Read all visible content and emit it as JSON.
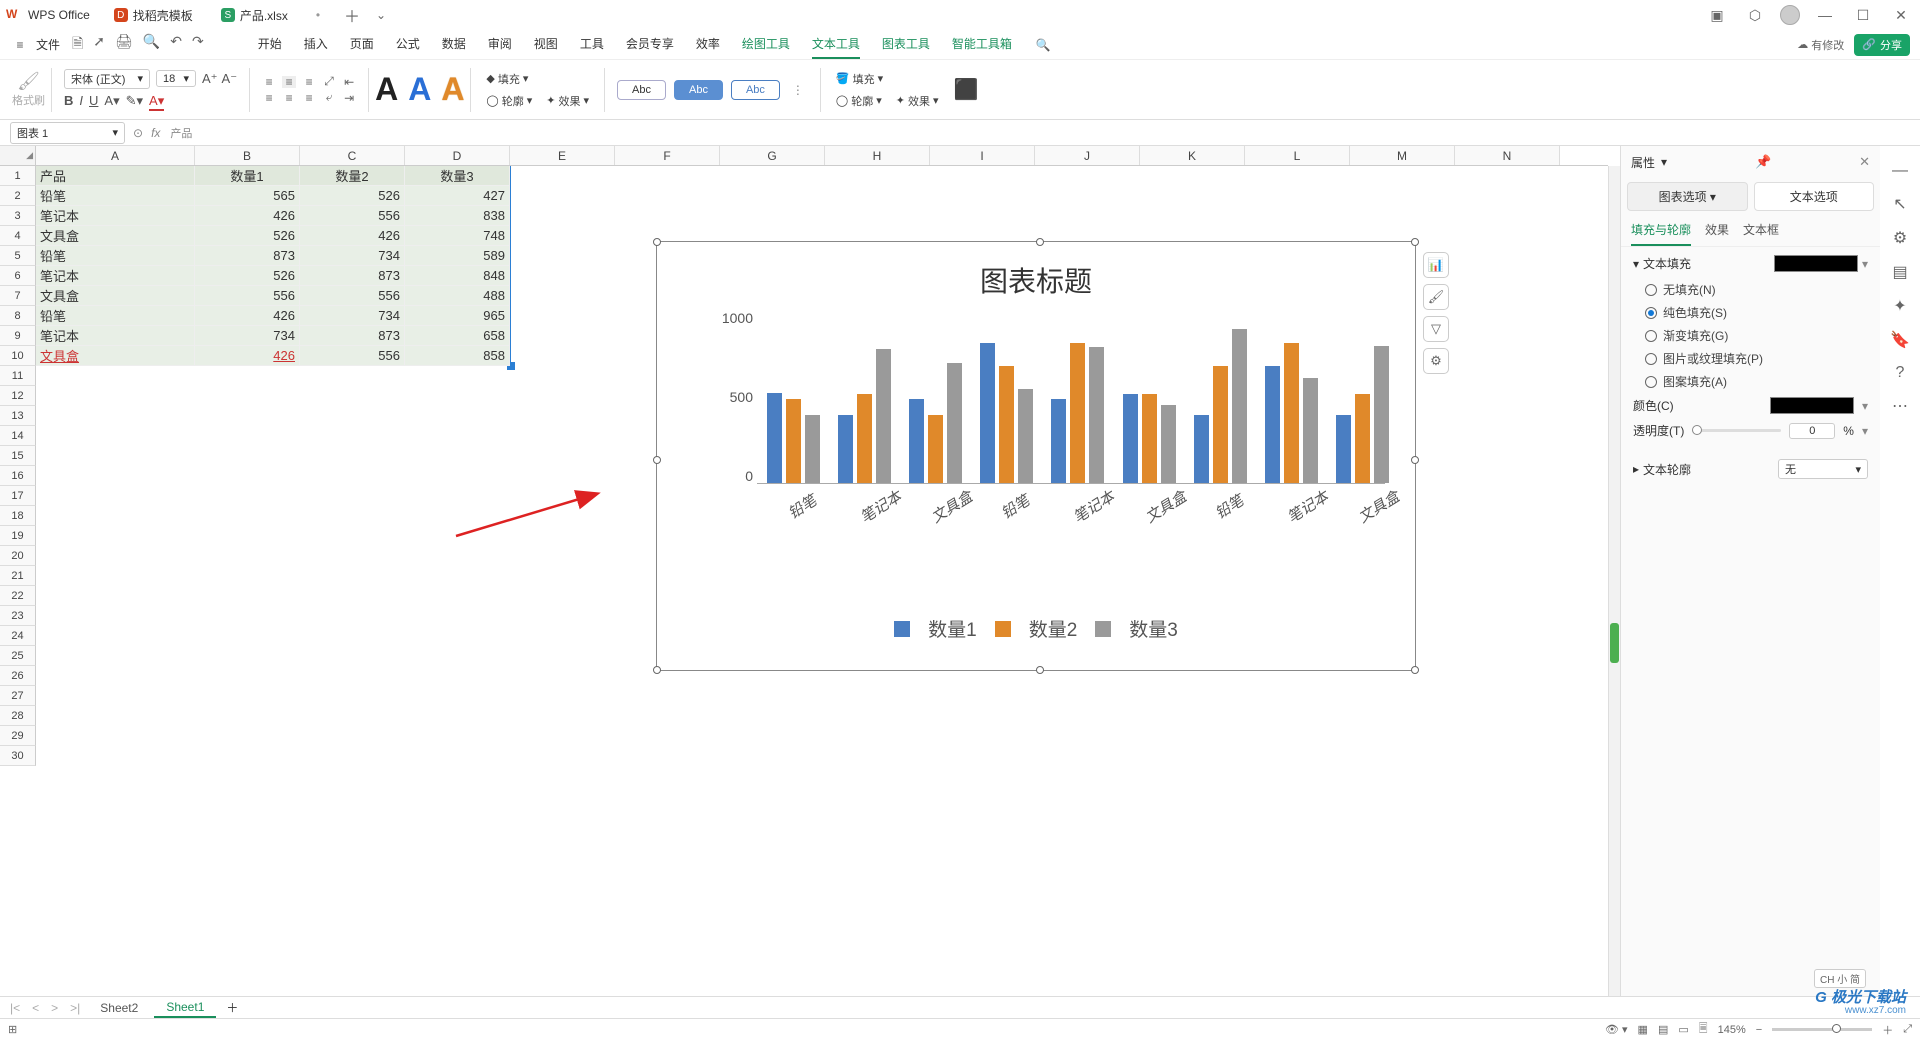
{
  "app": {
    "name": "WPS Office"
  },
  "tabs": [
    {
      "icon_bg": "#d4451c",
      "icon_txt": "D",
      "label": "找稻壳模板"
    },
    {
      "icon_bg": "#2b9e63",
      "icon_txt": "S",
      "label": "产品.xlsx",
      "active": true
    }
  ],
  "menu": {
    "file": "文件",
    "items": [
      "开始",
      "插入",
      "页面",
      "公式",
      "数据",
      "审阅",
      "视图",
      "工具",
      "会员专享",
      "效率",
      "绘图工具",
      "文本工具",
      "图表工具",
      "智能工具箱"
    ],
    "green_from": 10,
    "notice": "有修改",
    "share": "分享"
  },
  "ribbon": {
    "brush": "格式刷",
    "font_name": "宋体 (正文)",
    "font_size": "18",
    "bold": "B",
    "italic": "I",
    "underline": "U",
    "strike": "A",
    "bigA": [
      "A",
      "A",
      "A"
    ],
    "fill": "填充",
    "outline": "轮廓",
    "effect": "效果",
    "samples": [
      "Abc",
      "Abc",
      "Abc"
    ]
  },
  "fbar": {
    "name": "图表 1",
    "fx": "fx",
    "value": "产品"
  },
  "columns": [
    "A",
    "B",
    "C",
    "D",
    "E",
    "F",
    "G",
    "H",
    "I",
    "J",
    "K",
    "L",
    "M",
    "N"
  ],
  "table": {
    "headers": [
      "产品",
      "数量1",
      "数量2",
      "数量3"
    ],
    "rows": [
      [
        "铅笔",
        "565",
        "526",
        "427"
      ],
      [
        "笔记本",
        "426",
        "556",
        "838"
      ],
      [
        "文具盒",
        "526",
        "426",
        "748"
      ],
      [
        "铅笔",
        "873",
        "734",
        "589"
      ],
      [
        "笔记本",
        "526",
        "873",
        "848"
      ],
      [
        "文具盒",
        "556",
        "556",
        "488"
      ],
      [
        "铅笔",
        "426",
        "734",
        "965"
      ],
      [
        "笔记本",
        "734",
        "873",
        "658"
      ],
      [
        "文具盒",
        "426",
        "556",
        "858"
      ]
    ]
  },
  "chart_data": {
    "type": "bar",
    "title": "图表标题",
    "ylim": [
      0,
      1000
    ],
    "yticks": [
      "1000",
      "500",
      "0"
    ],
    "categories": [
      "铅笔",
      "笔记本",
      "文具盒",
      "铅笔",
      "笔记本",
      "文具盒",
      "铅笔",
      "笔记本",
      "文具盒"
    ],
    "series": [
      {
        "name": "数量1",
        "color": "#4a7ec2",
        "values": [
          565,
          426,
          526,
          873,
          526,
          556,
          426,
          734,
          426
        ]
      },
      {
        "name": "数量2",
        "color": "#e0892a",
        "values": [
          526,
          556,
          426,
          734,
          873,
          556,
          734,
          873,
          556
        ]
      },
      {
        "name": "数量3",
        "color": "#9a9a9a",
        "values": [
          427,
          838,
          748,
          589,
          848,
          488,
          965,
          658,
          858
        ]
      }
    ]
  },
  "side": {
    "title": "属性",
    "tabs": [
      "图表选项",
      "文本选项"
    ],
    "tab_on": 1,
    "subtabs": [
      "填充与轮廓",
      "效果",
      "文本框"
    ],
    "sub_on": 0,
    "sect_fill": "文本填充",
    "radios": [
      "无填充(N)",
      "纯色填充(S)",
      "渐变填充(G)",
      "图片或纹理填充(P)",
      "图案填充(A)"
    ],
    "radio_on": 1,
    "color_lbl": "颜色(C)",
    "trans_lbl": "透明度(T)",
    "trans_val": "0",
    "trans_unit": "%",
    "sect_line": "文本轮廓",
    "line_val": "无"
  },
  "sheets": {
    "list": [
      "Sheet2",
      "Sheet1"
    ],
    "active": 1
  },
  "status": {
    "ime": "CH 小 简",
    "zoom": "145%"
  }
}
